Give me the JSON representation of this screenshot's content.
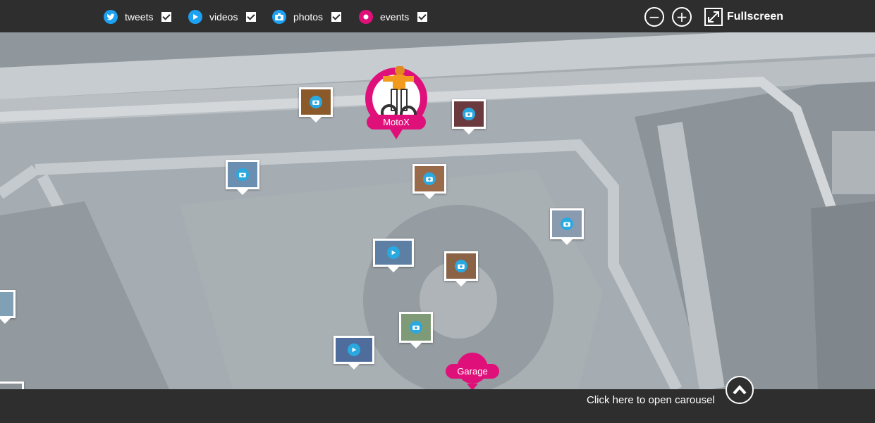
{
  "filters": [
    {
      "label": "tweets",
      "icon": "twitter-icon",
      "color": "#1da1f2",
      "checked": true
    },
    {
      "label": "videos",
      "icon": "play-icon",
      "color": "#1da1f2",
      "checked": true
    },
    {
      "label": "photos",
      "icon": "camera-icon",
      "color": "#1da1f2",
      "checked": true
    },
    {
      "label": "events",
      "icon": "event-dot-icon",
      "color": "#e0107a",
      "checked": true
    }
  ],
  "controls": {
    "zoom_out": "−",
    "zoom_in": "+",
    "fullscreen_label": "Fullscreen"
  },
  "events": [
    {
      "label": "MotoX"
    },
    {
      "label": "Garage"
    }
  ],
  "carousel": {
    "label": "Click here to open carousel"
  },
  "colors": {
    "bar": "#2e2e2e",
    "event_accent": "#e0107a",
    "media_accent": "#2aa8e0"
  }
}
